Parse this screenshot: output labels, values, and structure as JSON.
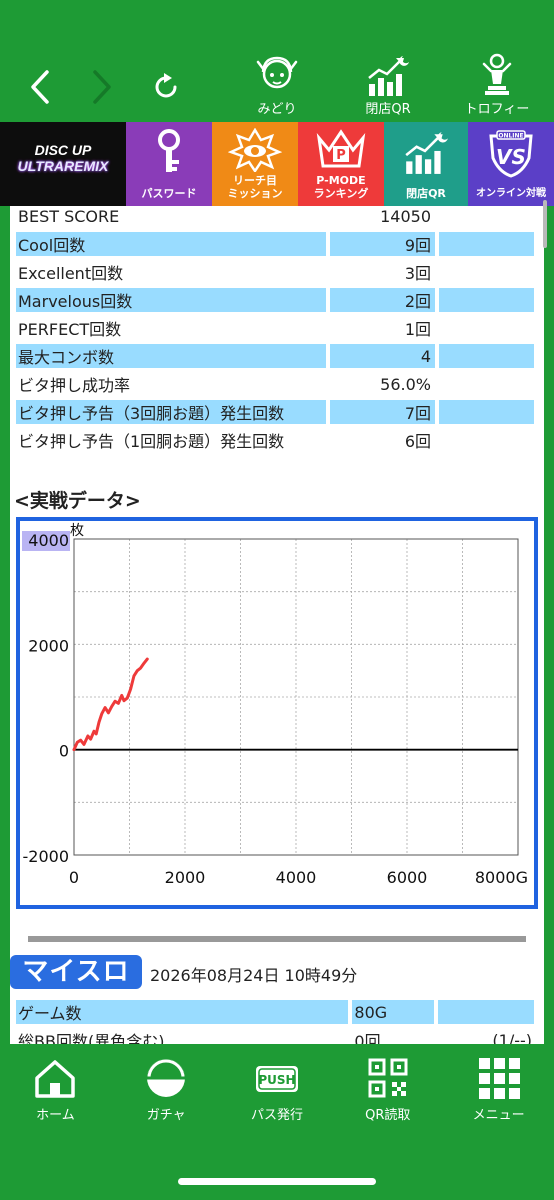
{
  "nav": {
    "back_icon": "chevron-left-icon",
    "forward_icon": "chevron-right-icon",
    "reload_icon": "reload-icon",
    "items": [
      {
        "label": "みどり",
        "icon": "midori-character-icon"
      },
      {
        "label": "閉店QR",
        "icon": "chart-moon-icon"
      },
      {
        "label": "トロフィー",
        "icon": "trophy-figure-icon"
      }
    ]
  },
  "banner": {
    "logo_top": "DISC UP",
    "logo_bottom": "ULTRAREMIX",
    "items": [
      {
        "label": "パスワード",
        "color": "#8a3cb8"
      },
      {
        "label_line1": "リーチ目",
        "label_line2": "ミッション",
        "color": "#f08a16"
      },
      {
        "label_line1": "P-MODE",
        "label_line2": "ランキング",
        "color": "#ee3a3a"
      },
      {
        "label": "閉店QR",
        "color": "#1f9e8a"
      },
      {
        "label": "オンライン対戦",
        "badge": "ONLINE",
        "mark": "VS",
        "color": "#5b3fc7"
      }
    ]
  },
  "stats": [
    {
      "label": "BEST SCORE",
      "value": "14050",
      "style": "white"
    },
    {
      "label": "Cool回数",
      "value": "9回",
      "style": "blue"
    },
    {
      "label": "Excellent回数",
      "value": "3回",
      "style": "white"
    },
    {
      "label": "Marvelous回数",
      "value": "2回",
      "style": "blue"
    },
    {
      "label": "PERFECT回数",
      "value": "1回",
      "style": "white"
    },
    {
      "label": "最大コンボ数",
      "value": "4",
      "style": "blue"
    },
    {
      "label": "ビタ押し成功率",
      "value": "56.0%",
      "style": "white"
    },
    {
      "label": "ビタ押し予告（3回胴お題）発生回数",
      "value": "7回",
      "style": "blue"
    },
    {
      "label": "ビタ押し予告（1回胴お題）発生回数",
      "value": "6回",
      "style": "white"
    }
  ],
  "section_title": "<実戦データ>",
  "chart_data": {
    "type": "line",
    "ylabel": "枚",
    "xlabel": "",
    "x_tick_labels": [
      "0",
      "2000",
      "4000",
      "6000",
      "8000G"
    ],
    "y_tick_labels": [
      "4000",
      "2000",
      "0",
      "-2000"
    ],
    "xlim": [
      0,
      8000
    ],
    "ylim": [
      -2000,
      4000
    ],
    "grid": true,
    "series": [
      {
        "color": "#ee3a3a",
        "x": [
          0,
          60,
          120,
          180,
          250,
          300,
          360,
          400,
          450,
          500,
          560,
          620,
          680,
          740,
          800,
          860,
          900,
          960,
          1020,
          1080,
          1140,
          1200,
          1260,
          1320
        ],
        "y": [
          0,
          140,
          180,
          100,
          260,
          200,
          350,
          300,
          520,
          680,
          800,
          700,
          820,
          920,
          880,
          1030,
          930,
          980,
          1150,
          1400,
          1500,
          1550,
          1640,
          1720
        ]
      }
    ]
  },
  "misuro": {
    "logo": "マイスロ",
    "date": "2026年08月24日 10時49分"
  },
  "stats2": [
    {
      "label": "ゲーム数",
      "value": "80G",
      "extra": "",
      "style": "blue"
    },
    {
      "label": "総BB回数(異色含む)",
      "value": "0回",
      "extra": "(1/--)",
      "style": "white"
    }
  ],
  "tabs": [
    {
      "label": "ホーム",
      "icon": "home-icon"
    },
    {
      "label": "ガチャ",
      "icon": "gacha-icon"
    },
    {
      "label": "パス発行",
      "icon": "push-icon",
      "badge": "PUSH"
    },
    {
      "label": "QR読取",
      "icon": "qr-code-icon"
    },
    {
      "label": "メニュー",
      "icon": "grid-menu-icon"
    }
  ]
}
